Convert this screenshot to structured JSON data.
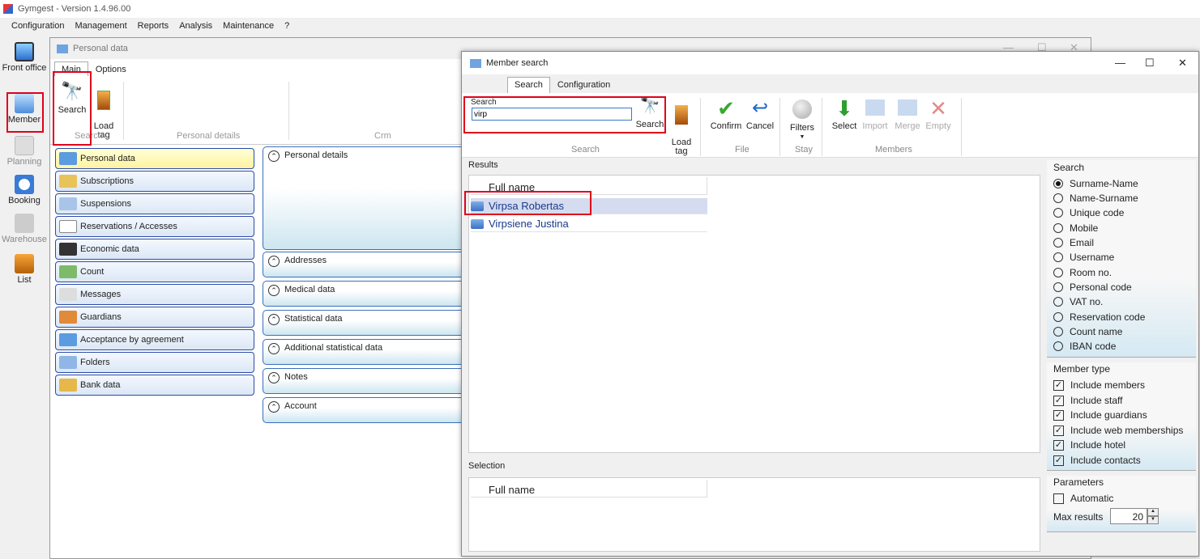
{
  "app": {
    "title": "Gymgest - Version 1.4.96.00"
  },
  "menu": [
    "Configuration",
    "Management",
    "Reports",
    "Analysis",
    "Maintenance",
    "?"
  ],
  "launcher": [
    {
      "label": "Front office",
      "icon": "monitor-icon"
    },
    {
      "label": "Member",
      "icon": "member-card-icon"
    },
    {
      "label": "Planning",
      "icon": "calendar-icon"
    },
    {
      "label": "Booking",
      "icon": "booking-clock-icon"
    },
    {
      "label": "Warehouse",
      "icon": "warehouse-icon"
    },
    {
      "label": "List",
      "icon": "briefcase-icon"
    }
  ],
  "personal_data": {
    "title": "Personal data",
    "tabs": [
      "Main",
      "Options"
    ],
    "ribbon": {
      "search_label": "Search",
      "load_tag_label": "Load\ntag",
      "groups": [
        "Search",
        "Personal details",
        "Crm"
      ]
    },
    "nav": [
      "Personal data",
      "Subscriptions",
      "Suspensions",
      "Reservations / Accesses",
      "Economic data",
      "Count",
      "Messages",
      "Guardians",
      "Acceptance by agreement",
      "Folders",
      "Bank data"
    ],
    "sections": [
      "Personal details",
      "Addresses",
      "Medical data",
      "Statistical data",
      "Additional statistical data",
      "Notes",
      "Account"
    ]
  },
  "member_search": {
    "title": "Member search",
    "tabs": [
      "Search",
      "Configuration"
    ],
    "search_box": {
      "label": "Search",
      "value": "virp",
      "button": "Search"
    },
    "ribbon_buttons": {
      "load_tag": "Load\ntag",
      "confirm": "Confirm",
      "cancel": "Cancel",
      "filters": "Filters",
      "select": "Select",
      "import": "Import",
      "merge": "Merge",
      "empty": "Empty"
    },
    "groups": [
      "Search",
      "File",
      "Stay",
      "Members"
    ],
    "results": {
      "label": "Results",
      "column": "Full name",
      "rows": [
        "Virpsa Robertas",
        "Virpsiene Justina"
      ]
    },
    "selection": {
      "label": "Selection",
      "column": "Full name"
    },
    "search_options": {
      "label": "Search",
      "items": [
        "Surname-Name",
        "Name-Surname",
        "Unique code",
        "Mobile",
        "Email",
        "Username",
        "Room no.",
        "Personal code",
        "VAT no.",
        "Reservation code",
        "Count name",
        "IBAN code"
      ],
      "selected": "Surname-Name"
    },
    "member_type": {
      "label": "Member type",
      "items": [
        "Include members",
        "Include staff",
        "Include guardians",
        "Include web memberships",
        "Include hotel",
        "Include contacts"
      ]
    },
    "parameters": {
      "label": "Parameters",
      "automatic": "Automatic",
      "max_results_label": "Max results",
      "max_results": "20"
    }
  },
  "colors": {
    "highlight": "#e0001b",
    "selected_row": "#d6dcef",
    "nav_border": "#2b4ba8"
  }
}
